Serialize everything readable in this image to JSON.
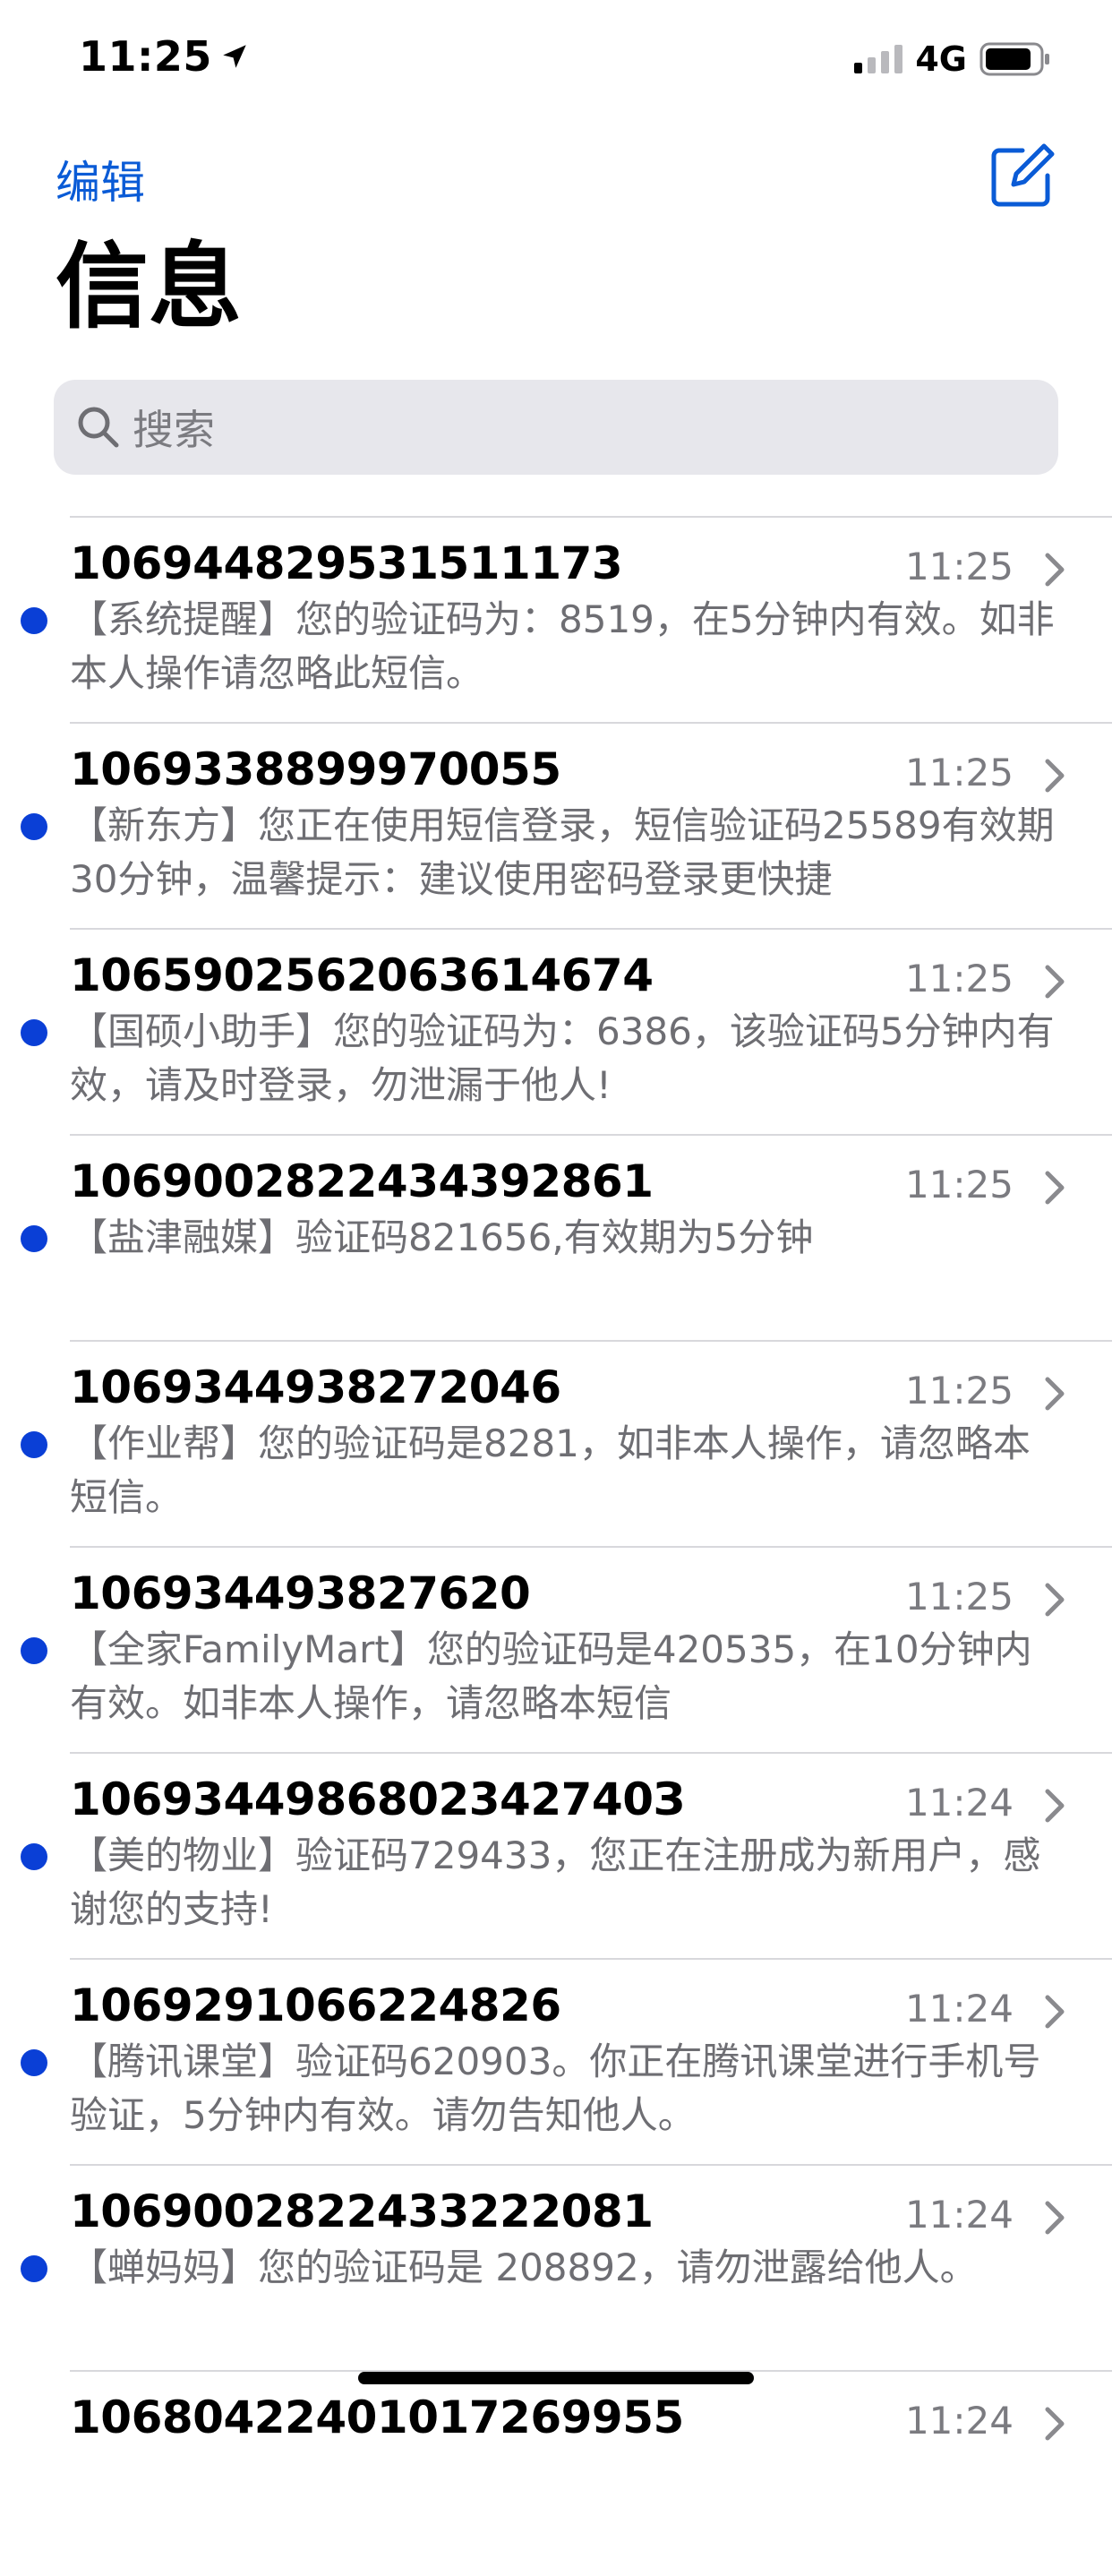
{
  "status_bar": {
    "time": "11:25",
    "network": "4G"
  },
  "nav": {
    "edit_label": "编辑"
  },
  "page_title": "信息",
  "search": {
    "placeholder": "搜索"
  },
  "messages": [
    {
      "sender": "106944829531511173",
      "time": "11:25",
      "preview": "【系统提醒】您的验证码为：8519，在5分钟内有效。如非本人操作请忽略此短信。"
    },
    {
      "sender": "1069338899970055",
      "time": "11:25",
      "preview": "【新东方】您正在使用短信登录，短信验证码25589有效期30分钟，温馨提示：建议使用密码登录更快捷"
    },
    {
      "sender": "1065902562063614674",
      "time": "11:25",
      "preview": "【国硕小助手】您的验证码为：6386，该验证码5分钟内有效，请及时登录，勿泄漏于他人!"
    },
    {
      "sender": "1069002822434392861",
      "time": "11:25",
      "preview": "【盐津融媒】验证码821656,有效期为5分钟"
    },
    {
      "sender": "1069344938272046",
      "time": "11:25",
      "preview": "【作业帮】您的验证码是8281，如非本人操作，请忽略本短信。"
    },
    {
      "sender": "106934493827620",
      "time": "11:25",
      "preview": "【全家FamilyMart】您的验证码是420535，在10分钟内有效。如非本人操作，请忽略本短信"
    },
    {
      "sender": "1069344986802342740З",
      "time": "11:24",
      "preview": "【美的物业】验证码729433，您正在注册成为新用户，感谢您的支持!"
    },
    {
      "sender": "1069291066224826",
      "time": "11:24",
      "preview": "【腾讯课堂】验证码620903。你正在腾讯课堂进行手机号验证，5分钟内有效。请勿告知他人。"
    },
    {
      "sender": "1069002822433222081",
      "time": "11:24",
      "preview": "【蝉妈妈】您的验证码是 208892，请勿泄露给他人。"
    },
    {
      "sender": "10680422401017269955",
      "time": "11:24",
      "preview": ""
    }
  ],
  "colors": {
    "accent": "#0a5bd6",
    "unread_dot": "#0a3fd6",
    "secondary_text": "#6e6e73"
  }
}
